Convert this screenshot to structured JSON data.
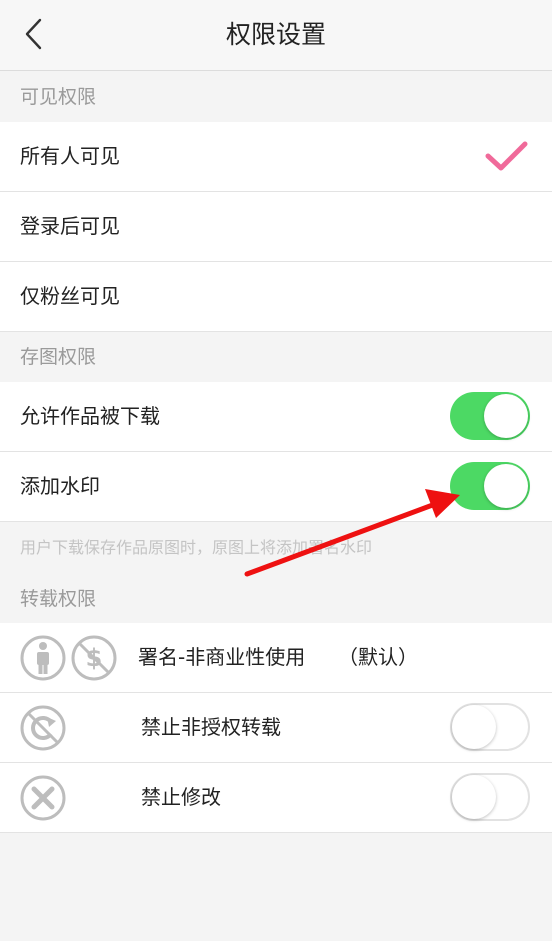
{
  "header": {
    "title": "权限设置",
    "back_icon": "chevron-left-icon"
  },
  "visibility": {
    "section_title": "可见权限",
    "options": [
      {
        "label": "所有人可见",
        "selected": true
      },
      {
        "label": "登录后可见",
        "selected": false
      },
      {
        "label": "仅粉丝可见",
        "selected": false
      }
    ]
  },
  "save": {
    "section_title": "存图权限",
    "allow_download": {
      "label": "允许作品被下载",
      "on": true
    },
    "watermark": {
      "label": "添加水印",
      "on": true
    },
    "hint": "用户下载保存作品原图时，原图上将添加署名水印"
  },
  "repost": {
    "section_title": "转载权限",
    "attribution": {
      "label": "署名-非商业性使用",
      "tag": "（默认）",
      "icons": [
        "person-icon",
        "no-commercial-icon"
      ]
    },
    "no_repost": {
      "label": "禁止非授权转载",
      "on": false,
      "icon": "no-repost-icon"
    },
    "no_modify": {
      "label": "禁止修改",
      "on": false,
      "icon": "no-modify-icon"
    }
  },
  "colors": {
    "accent_pink": "#f06a9a",
    "toggle_on": "#4cd964",
    "arrow": "#ee1111"
  }
}
